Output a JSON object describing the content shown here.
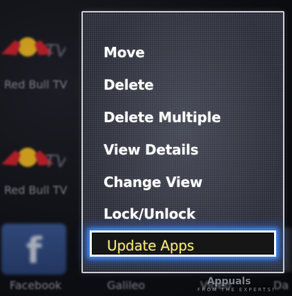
{
  "background_apps": [
    {
      "label": "Red Bull TV",
      "icon": "red-bull-tv-logo"
    },
    {
      "label": "Red Bull TV",
      "icon": "red-bull-tv-logo"
    },
    {
      "label": "Facebook",
      "icon": "facebook-icon"
    },
    {
      "label": "Galileo",
      "icon": "galileo-icon"
    },
    {
      "label": "Video",
      "icon": "video-icon"
    },
    {
      "label": "Da",
      "icon": "app-icon"
    }
  ],
  "context_menu": {
    "items": [
      {
        "label": "Move",
        "selected": false
      },
      {
        "label": "Delete",
        "selected": false
      },
      {
        "label": "Delete Multiple",
        "selected": false
      },
      {
        "label": "View Details",
        "selected": false
      },
      {
        "label": "Change View",
        "selected": false
      },
      {
        "label": "Lock/Unlock",
        "selected": false
      },
      {
        "label": "Update Apps",
        "selected": true
      }
    ],
    "highlight_text_color": "#f0e26a",
    "highlight_glow_color": "#2f7bff"
  },
  "watermark": {
    "brand": "Appuals",
    "tagline": "FROM THE EXPERTS!"
  }
}
